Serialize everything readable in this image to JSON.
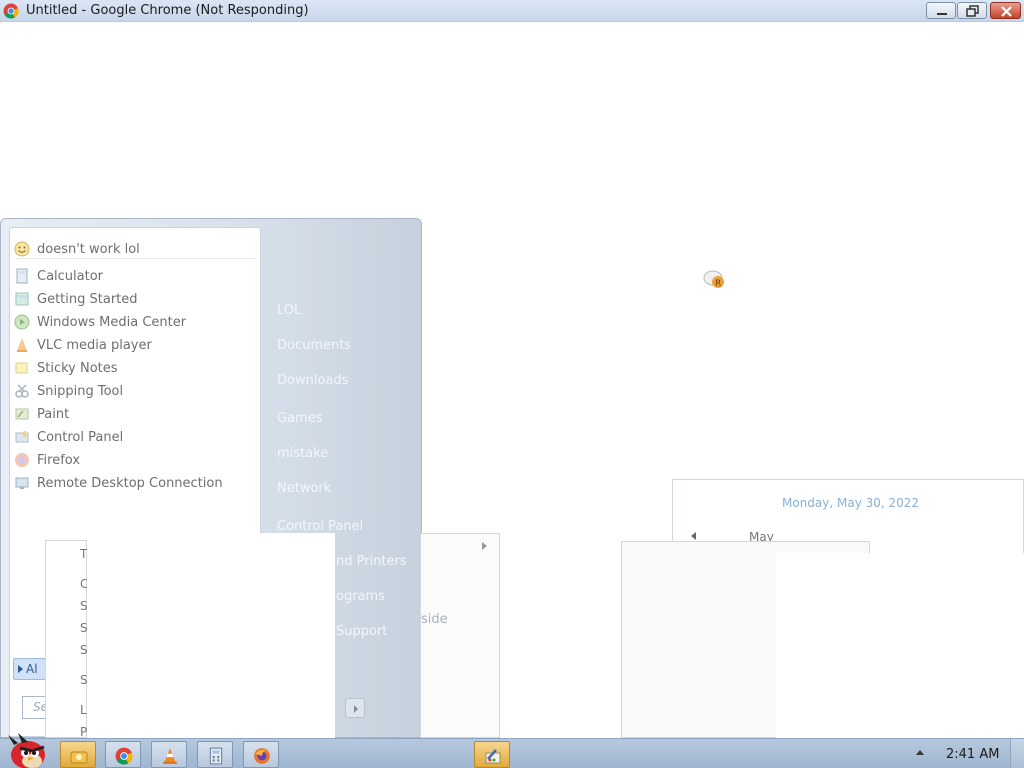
{
  "window": {
    "title": "Untitled - Google Chrome (Not Responding)",
    "icon": "chrome-icon"
  },
  "start_menu": {
    "pinned": [
      {
        "label": "doesn't work lol",
        "icon": "smiley-icon"
      }
    ],
    "recent": [
      {
        "label": "Calculator",
        "icon": "calculator-icon"
      },
      {
        "label": "Getting Started",
        "icon": "getting-started-icon"
      },
      {
        "label": "Windows Media Center",
        "icon": "media-center-icon"
      },
      {
        "label": "VLC media player",
        "icon": "vlc-icon"
      },
      {
        "label": "Sticky Notes",
        "icon": "sticky-notes-icon"
      },
      {
        "label": "Snipping Tool",
        "icon": "snipping-tool-icon"
      },
      {
        "label": "Paint",
        "icon": "paint-icon"
      },
      {
        "label": "Control Panel",
        "icon": "control-panel-icon"
      },
      {
        "label": "Firefox",
        "icon": "firefox-icon"
      },
      {
        "label": "Remote Desktop Connection",
        "icon": "remote-desktop-icon"
      }
    ],
    "right_links": [
      {
        "label": "LOL"
      },
      {
        "label": "Documents"
      },
      {
        "label": "Downloads"
      },
      {
        "label": "Games"
      },
      {
        "label": "mistake"
      },
      {
        "label": "Network"
      },
      {
        "label": "Control Panel"
      },
      {
        "label": "nd Printers"
      },
      {
        "label": "ograms"
      },
      {
        "label": "Support"
      }
    ],
    "all_programs_label": "Al",
    "search_placeholder": "Se"
  },
  "context_menu": {
    "letters": [
      "T",
      "C",
      "S",
      "S",
      "S",
      "S",
      "L",
      "P"
    ],
    "partial_text": "side"
  },
  "calendar": {
    "date": "Monday, May 30, 2022",
    "month": "May"
  },
  "taskbar": {
    "clock": "2:41 AM",
    "buttons": [
      {
        "name": "explorer-icon"
      },
      {
        "name": "chrome-icon"
      },
      {
        "name": "vlc-icon"
      },
      {
        "name": "calculator-icon"
      },
      {
        "name": "firefox-icon"
      },
      {
        "name": "paint-icon",
        "active": true
      }
    ]
  }
}
